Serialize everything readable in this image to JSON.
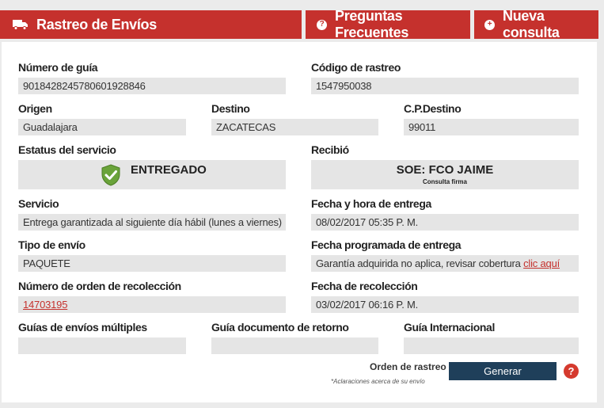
{
  "tabs": {
    "tracking": "Rastreo de Envíos",
    "faq": "Preguntas Frecuentes",
    "new_query": "Nueva consulta",
    "faq_icon_glyph": "?",
    "new_icon_glyph": "+"
  },
  "fields": {
    "guide_number": {
      "label": "Número de guía",
      "value": "9018428245780601928846"
    },
    "tracking_code": {
      "label": "Código de rastreo",
      "value": "1547950038"
    },
    "origin": {
      "label": "Origen",
      "value": "Guadalajara"
    },
    "destination": {
      "label": "Destino",
      "value": "ZACATECAS"
    },
    "zip_destination": {
      "label": "C.P.Destino",
      "value": "99011"
    },
    "service_status": {
      "label": "Estatus del servicio",
      "value": "ENTREGADO"
    },
    "received_by": {
      "label": "Recibió",
      "value": "SOE: FCO JAIME",
      "sub": "Consulta firma"
    },
    "service": {
      "label": "Servicio",
      "value": "Entrega garantizada al siguiente día hábil (lunes a viernes)"
    },
    "delivery_datetime": {
      "label": "Fecha y hora de entrega",
      "value": "08/02/2017 05:35 P. M."
    },
    "shipment_type": {
      "label": "Tipo de envío",
      "value": "PAQUETE"
    },
    "scheduled_delivery": {
      "label": "Fecha programada de entrega",
      "value": "Garantía adquirida no aplica, revisar cobertura",
      "link": "clic aquí"
    },
    "pickup_order": {
      "label": "Número de orden de recolección",
      "value": "14703195"
    },
    "pickup_date": {
      "label": "Fecha de recolección",
      "value": "03/02/2017 06:16 P. M."
    },
    "multi_guides": {
      "label": "Guías de envíos múltiples",
      "value": ""
    },
    "return_doc": {
      "label": "Guía documento de retorno",
      "value": ""
    },
    "international": {
      "label": "Guía Internacional",
      "value": ""
    }
  },
  "footer": {
    "order_label": "Orden de rastreo",
    "generate": "Generar",
    "note": "*Aclaraciones acerca de su envío",
    "help_glyph": "?"
  },
  "colors": {
    "brand_red": "#c5312d",
    "button_navy": "#1f3f5a",
    "check_green": "#6aa33a"
  },
  "icons": {
    "tracking": "truck-icon",
    "faq": "question-circle-icon",
    "new_query": "plus-circle-icon",
    "status": "shield-check-icon",
    "help": "help-icon"
  }
}
